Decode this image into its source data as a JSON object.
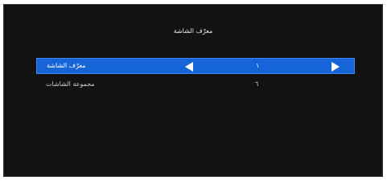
{
  "window": {
    "title": "معرّف الشاشة"
  },
  "menu": {
    "items": [
      {
        "label": "معرّف الشاشة",
        "value": "١",
        "selected": true
      },
      {
        "label": "مجموعة الشاشات",
        "value": "٦",
        "selected": false
      }
    ]
  },
  "icons": {
    "left_arrow": "left-arrow-icon",
    "right_arrow": "right-arrow-icon"
  },
  "colors": {
    "background": "#121212",
    "selection": "#1565d8",
    "text": "#ffffff"
  }
}
